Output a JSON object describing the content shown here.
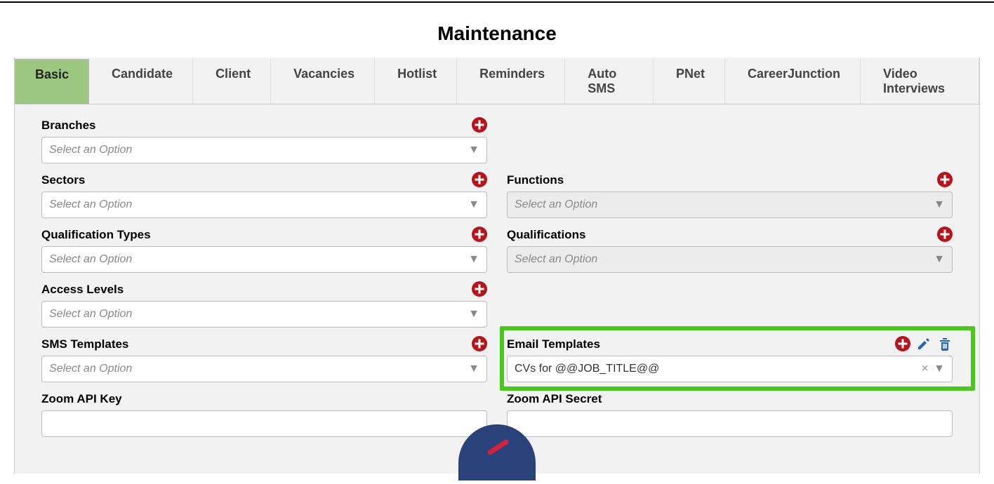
{
  "page_title": "Maintenance",
  "tabs": [
    {
      "label": "Basic",
      "active": true
    },
    {
      "label": "Candidate"
    },
    {
      "label": "Client"
    },
    {
      "label": "Vacancies"
    },
    {
      "label": "Hotlist"
    },
    {
      "label": "Reminders"
    },
    {
      "label": "Auto SMS"
    },
    {
      "label": "PNet"
    },
    {
      "label": "CareerJunction"
    },
    {
      "label": "Video Interviews"
    }
  ],
  "placeholder": "Select an Option",
  "fields": {
    "branches": {
      "label": "Branches"
    },
    "sectors": {
      "label": "Sectors"
    },
    "functions": {
      "label": "Functions"
    },
    "qualification_types": {
      "label": "Qualification Types"
    },
    "qualifications": {
      "label": "Qualifications"
    },
    "access_levels": {
      "label": "Access Levels"
    },
    "sms_templates": {
      "label": "SMS Templates"
    },
    "email_templates": {
      "label": "Email Templates",
      "value": "CVs for @@JOB_TITLE@@"
    },
    "zoom_api_key": {
      "label": "Zoom API Key"
    },
    "zoom_api_secret": {
      "label": "Zoom API Secret"
    }
  },
  "colors": {
    "accent_red": "#b8131a",
    "edit_blue": "#1f63c4",
    "trash_blue": "#1f63c4",
    "highlight": "#46c919"
  }
}
